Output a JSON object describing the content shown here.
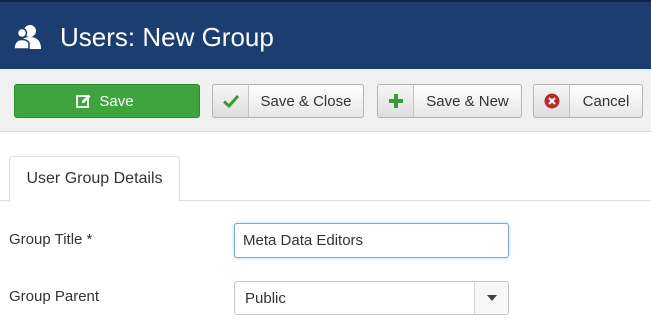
{
  "header": {
    "title": "Users: New Group",
    "icon": "users-icon",
    "background_color": "#1c3d6f"
  },
  "toolbar": {
    "save_label": "Save",
    "save_icon": "edit-icon",
    "save_color": "#3ea53e",
    "save_close_label": "Save & Close",
    "save_close_icon": "checkmark-icon",
    "save_new_label": "Save & New",
    "save_new_icon": "plus-icon",
    "cancel_label": "Cancel",
    "cancel_icon": "cancel-circle-icon"
  },
  "tabs": [
    {
      "label": "User Group Details",
      "active": true
    }
  ],
  "form": {
    "group_title_label": "Group Title *",
    "group_title_value": "Meta Data Editors",
    "group_parent_label": "Group Parent",
    "group_parent_value": "Public"
  }
}
